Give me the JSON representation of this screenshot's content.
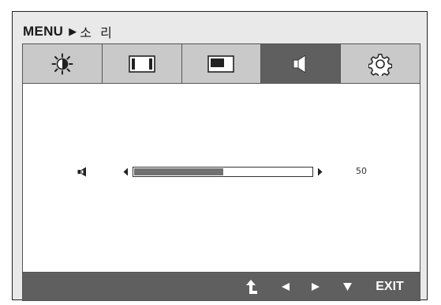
{
  "breadcrumb": {
    "menu": "MENU",
    "separator": "▶",
    "title": "소 리"
  },
  "tabs": [
    {
      "name": "brightness",
      "icon": "brightness-sun-icon",
      "active": false
    },
    {
      "name": "picture",
      "icon": "picture-frame-icon",
      "active": false
    },
    {
      "name": "screen",
      "icon": "screen-corner-icon",
      "active": false
    },
    {
      "name": "sound",
      "icon": "speaker-icon",
      "active": true
    },
    {
      "name": "settings",
      "icon": "gear-icon",
      "active": false
    }
  ],
  "volume": {
    "icon": "speaker-small-icon",
    "value": 50,
    "value_label": "50"
  },
  "bottom_bar": {
    "exit_label": "EXIT",
    "buttons": [
      "return-icon",
      "left-arrow-icon",
      "right-arrow-icon",
      "down-arrow-icon"
    ]
  },
  "colors": {
    "frame_bg": "#e9e9e9",
    "tab_bg": "#c9c9c9",
    "active_tab_bg": "#5f5f5f",
    "panel_bg": "#ffffff",
    "slider_fill": "#707070"
  }
}
